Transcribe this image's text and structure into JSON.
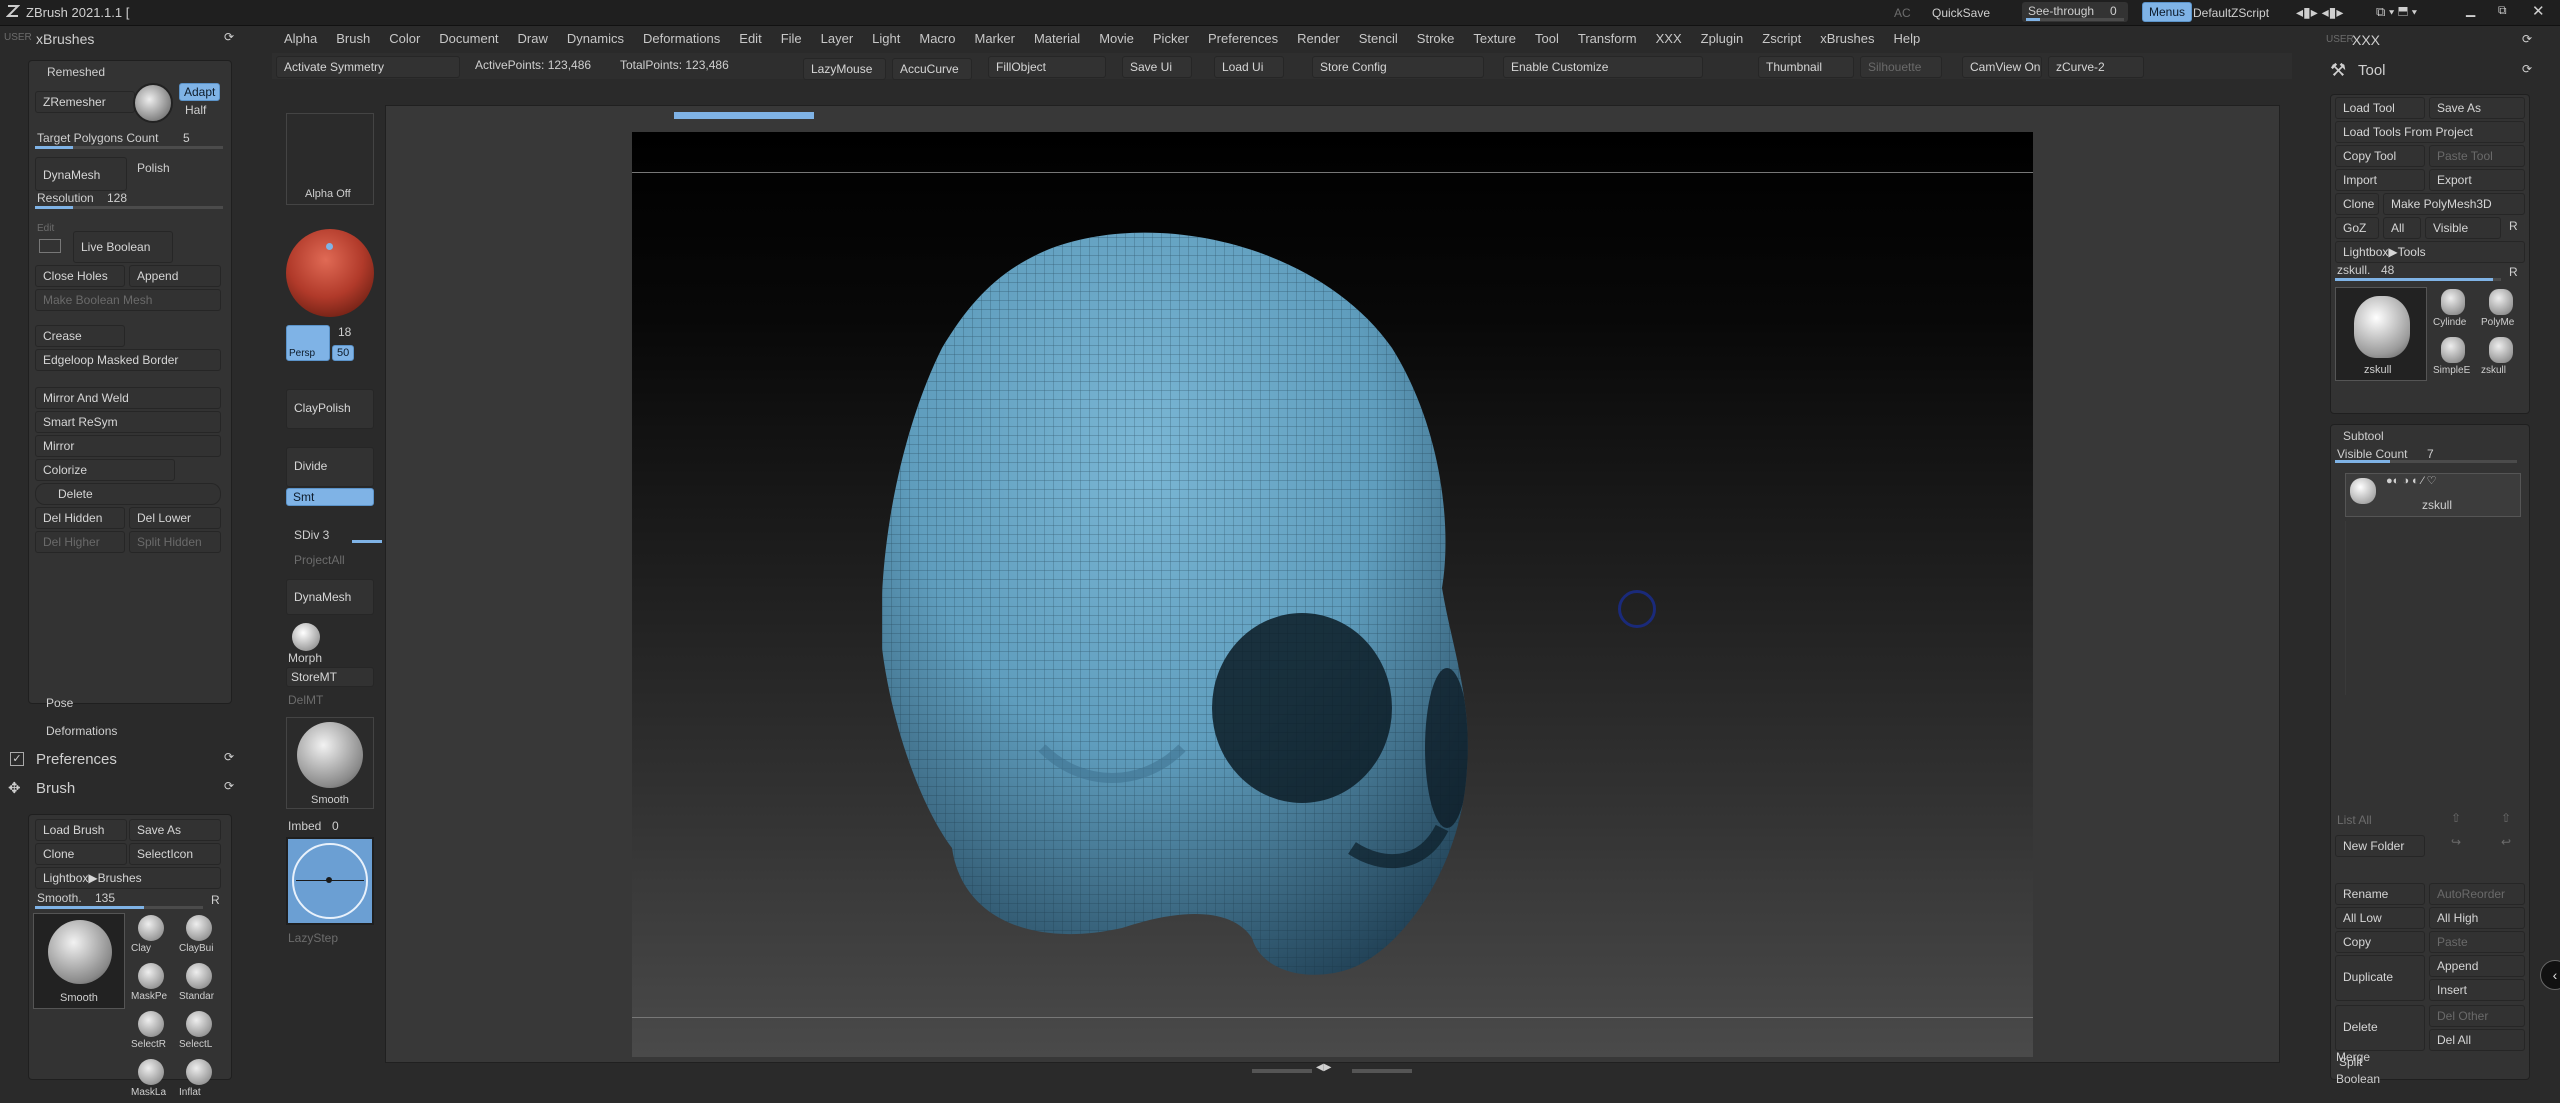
{
  "app": {
    "title": "ZBrush 2021.1.1 [",
    "ac_label": "AC",
    "quicksave": "QuickSave",
    "see_through_label": "See-through",
    "see_through_value": "0",
    "menus_label": "Menus",
    "script_label": "DefaultZScript"
  },
  "menu": [
    "Alpha",
    "Brush",
    "Color",
    "Document",
    "Draw",
    "Dynamics",
    "Deformations",
    "Edit",
    "File",
    "Layer",
    "Light",
    "Macro",
    "Marker",
    "Material",
    "Movie",
    "Picker",
    "Preferences",
    "Render",
    "Stencil",
    "Stroke",
    "Texture",
    "Tool",
    "Transform",
    "XXX",
    "Zplugin",
    "Zscript",
    "xBrushes",
    "Help"
  ],
  "topbar": {
    "activate_symmetry": "Activate Symmetry",
    "active_points": "ActivePoints: 123,486",
    "total_points": "TotalPoints: 123,486",
    "lazymouse": "LazyMouse",
    "accucurve": "AccuCurve",
    "fillobject": "FillObject",
    "save_ui": "Save Ui",
    "load_ui": "Load Ui",
    "store_config": "Store Config",
    "enable_customize": "Enable Customize",
    "thumbnail": "Thumbnail",
    "silhouette": "Silhouette",
    "camview": "CamView On",
    "zcurve": "zCurve-2"
  },
  "left": {
    "user_label": "USER",
    "xbrushes_title": "xBrushes",
    "remeshed_title": "Remeshed",
    "zremesher": "ZRemesher",
    "adapt": "Adapt",
    "half": "Half",
    "target_polygons": "Target Polygons Count",
    "target_polygons_value": "5",
    "target_polygons_fill": 0.2,
    "dynamesh": "DynaMesh",
    "polish": "Polish",
    "resolution": "Resolution",
    "resolution_value": "128",
    "resolution_fill": 0.2,
    "edit": "Edit",
    "live_boolean": "Live Boolean",
    "close_holes": "Close Holes",
    "append": "Append",
    "make_boolean_mesh": "Make Boolean Mesh",
    "crease": "Crease",
    "edgeloop": "Edgeloop Masked Border",
    "mirror_and_weld": "Mirror And Weld",
    "smart_resym": "Smart ReSym",
    "mirror": "Mirror",
    "colorize": "Colorize",
    "delete": "Delete",
    "del_hidden": "Del Hidden",
    "del_lower": "Del Lower",
    "del_higher": "Del Higher",
    "split_hidden": "Split Hidden",
    "pose": "Pose",
    "deformations": "Deformations",
    "preferences": "Preferences",
    "brush": "Brush",
    "load_brush": "Load Brush",
    "save_as": "Save As",
    "clone": "Clone",
    "selecticon": "SelectIcon",
    "lightbox_brushes": "Lightbox▶Brushes",
    "smooth_label": "Smooth.",
    "smooth_value": "135",
    "smooth_fill": 0.65,
    "r_label": "R",
    "brush_current": "Smooth",
    "brush_thumbs": [
      "Clay",
      "ClayBui",
      "MaskPe",
      "Standar",
      "SelectR",
      "SelectL",
      "MaskLa",
      "Inflat"
    ]
  },
  "shelf": {
    "alpha_off": "Alpha Off",
    "persp": "Persp",
    "value_18": "18",
    "value_50": "50",
    "claypolish": "ClayPolish",
    "divide": "Divide",
    "smt": "Smt",
    "sdiv": "SDiv 3",
    "projectall": "ProjectAll",
    "dynamesh": "DynaMesh",
    "morph": "Morph",
    "storemt": "StoreMT",
    "delmt": "DelMT",
    "smooth": "Smooth",
    "imbed": "Imbed",
    "imbed_value": "0",
    "lazystep": "LazyStep"
  },
  "right": {
    "user_label": "USER",
    "xxx": "XXX",
    "tool_title": "Tool",
    "load_tool": "Load Tool",
    "save_as": "Save As",
    "load_from_project": "Load Tools From Project",
    "copy_tool": "Copy Tool",
    "paste_tool": "Paste Tool",
    "import": "Import",
    "export": "Export",
    "clone": "Clone",
    "make_polymesh": "Make PolyMesh3D",
    "goz": "GoZ",
    "all": "All",
    "visible": "Visible",
    "r": "R",
    "lightbox_tools": "Lightbox▶Tools",
    "zskull_label": "zskull.",
    "zskull_value": "48",
    "zskull_fill": 0.95,
    "tool_main": "zskull",
    "tool_thumbs": [
      "Cylinde",
      "PolyMe",
      "SimpleE",
      "zskull"
    ],
    "subtool_title": "Subtool",
    "visible_count": "Visible Count",
    "visible_count_value": "7",
    "visible_count_fill": 0.3,
    "subtool_item": "zskull",
    "list_all": "List All",
    "new_folder": "New Folder",
    "rename": "Rename",
    "autoreorder": "AutoReorder",
    "all_low": "All Low",
    "all_high": "All High",
    "copy": "Copy",
    "paste": "Paste",
    "duplicate": "Duplicate",
    "append": "Append",
    "insert": "Insert",
    "delete": "Delete",
    "del_other": "Del Other",
    "del_all": "Del All",
    "split": "Split",
    "merge": "Merge",
    "boolean": "Boolean"
  },
  "colors": {
    "accent": "#7fb3e6",
    "skull": "#5f9dbd",
    "material_sphere": "#b13a2a"
  }
}
